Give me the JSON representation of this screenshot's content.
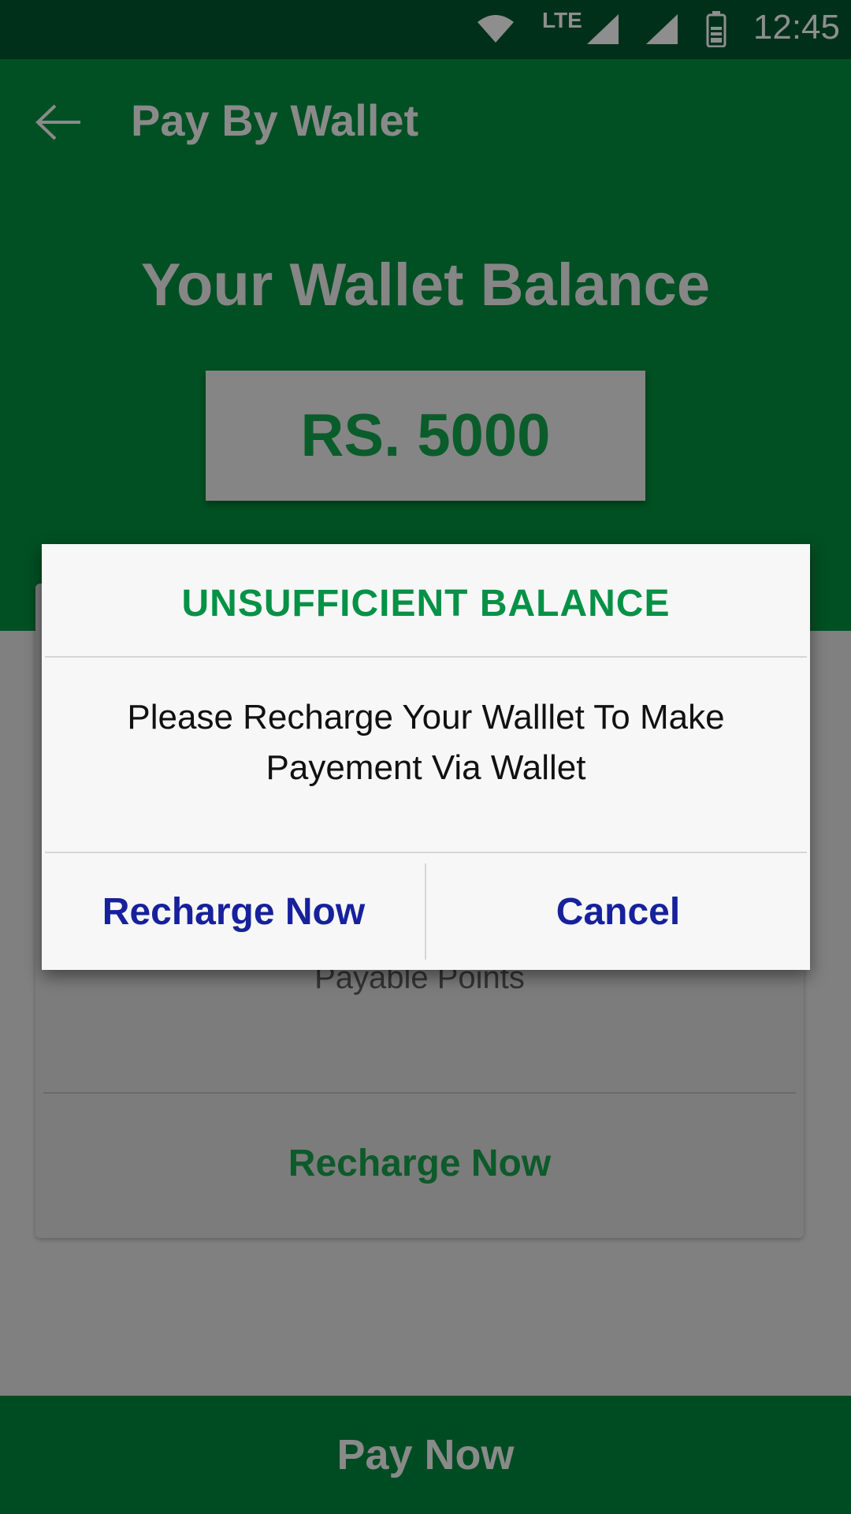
{
  "status_bar": {
    "network_label": "LTE",
    "time": "12:45"
  },
  "app_bar": {
    "title": "Pay By Wallet"
  },
  "wallet": {
    "heading": "Your Wallet Balance",
    "balance": "RS. 5000"
  },
  "background_card": {
    "payable_points_label": "Payable Points",
    "recharge_label": "Recharge Now"
  },
  "bottom_bar": {
    "pay_now_label": "Pay Now"
  },
  "dialog": {
    "title": "UNSUFFICIENT BALANCE",
    "message": "Please Recharge Your Walllet To Make Payement Via Wallet",
    "recharge_button": "Recharge Now",
    "cancel_button": "Cancel"
  },
  "colors": {
    "header_green": "#005023",
    "dialog_title_green": "#059146",
    "dialog_button_blue": "#17219c",
    "scrim_gray": "#808080"
  }
}
